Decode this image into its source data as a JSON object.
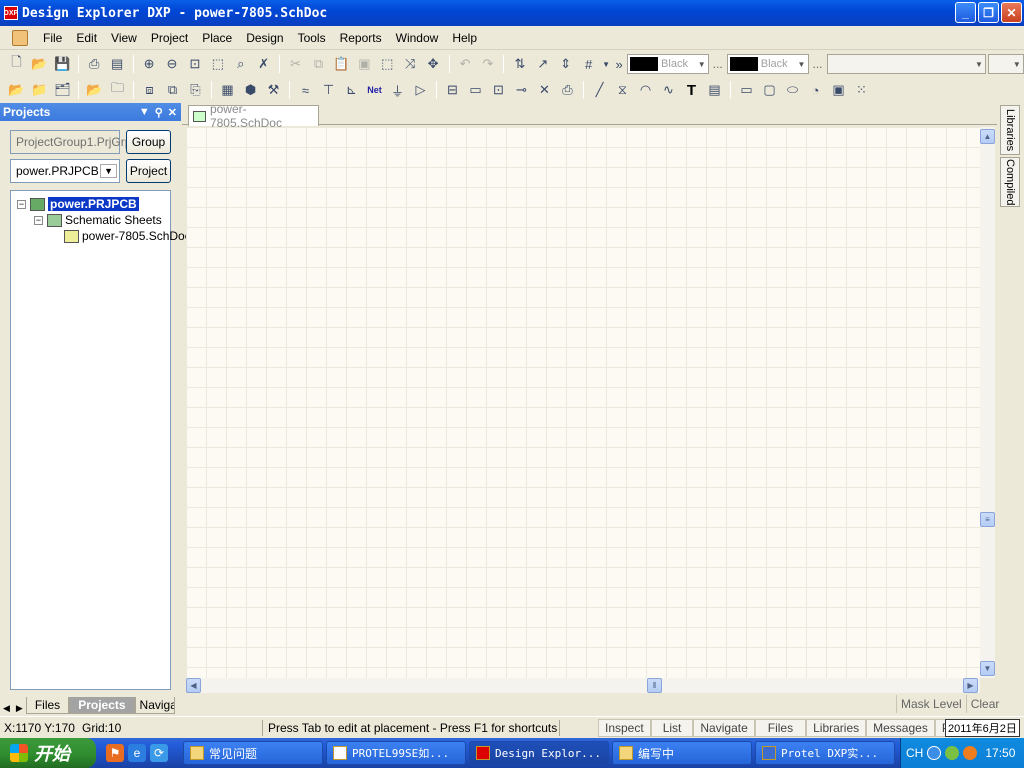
{
  "window": {
    "title": "Design Explorer DXP - power-7805.SchDoc",
    "logo_text": "DXP",
    "minimize": "_",
    "maximize": "❐",
    "close": "✕"
  },
  "menu": [
    "File",
    "Edit",
    "View",
    "Project",
    "Place",
    "Design",
    "Tools",
    "Reports",
    "Window",
    "Help"
  ],
  "toolbar": {
    "line_color_label": "Black",
    "fill_color_label": "Black",
    "more": "»",
    "ellipsis": "..."
  },
  "projects_panel": {
    "title": "Projects",
    "group_field": "ProjectGroup1.PrjGrp",
    "group_button": "Group",
    "project_select": "power.PRJPCB",
    "project_button": "Project",
    "tree": {
      "project": "power.PRJPCB",
      "folder": "Schematic Sheets",
      "document": "power-7805.SchDoc"
    },
    "tabs": [
      "Files",
      "Projects",
      "Navigator"
    ]
  },
  "document": {
    "tab_label": "power-7805.SchDoc",
    "accent": "#0a37c6"
  },
  "right_bar": [
    "Libraries",
    "Compiled"
  ],
  "mask": {
    "level": "Mask Level",
    "clear": "Clear"
  },
  "status": {
    "coords": "X:1170 Y:170",
    "grid": "Grid:10",
    "hint": "Press Tab to edit at placement - Press F1 for shortcuts",
    "panel_tabs": [
      "Inspect",
      "List",
      "Navigate",
      "Files",
      "Libraries",
      "Messages",
      "Projects"
    ],
    "date": "2011年6月2日"
  },
  "taskbar": {
    "start": "开始",
    "tasks": [
      "常见问题",
      "PROTEL99SE如...",
      "Design Explor...",
      "编写中",
      "Protel DXP实..."
    ],
    "lang": "CH",
    "clock": "17:50"
  }
}
